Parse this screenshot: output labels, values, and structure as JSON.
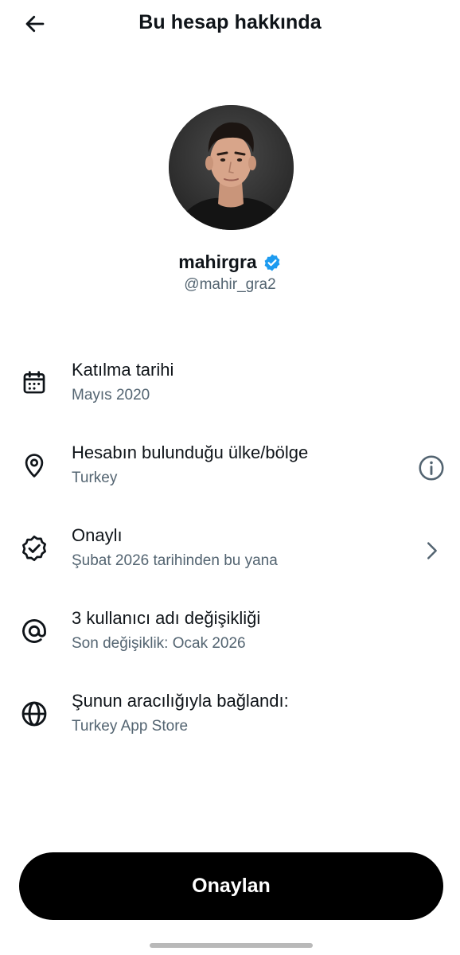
{
  "header": {
    "title": "Bu hesap hakkında",
    "back_icon": "arrow-left-icon"
  },
  "profile": {
    "display_name": "mahirgra",
    "handle": "@mahir_gra2",
    "verified": true,
    "verified_color": "#1d9bf0"
  },
  "info": [
    {
      "icon": "calendar-icon",
      "title": "Katılma tarihi",
      "subtitle": "Mayıs 2020"
    },
    {
      "icon": "location-pin-icon",
      "title": "Hesabın bulunduğu ülke/bölge",
      "subtitle": "Turkey",
      "trailing": "info-icon"
    },
    {
      "icon": "verified-badge-outline-icon",
      "title": "Onaylı",
      "subtitle": "Şubat 2026 tarihinden bu yana",
      "trailing": "chevron-right-icon"
    },
    {
      "icon": "at-sign-icon",
      "title": "3 kullanıcı adı değişikliği",
      "subtitle": "Son değişiklik: Ocak 2026"
    },
    {
      "icon": "globe-icon",
      "title": "Şunun aracılığıyla bağlandı:",
      "subtitle": "Turkey App Store"
    }
  ],
  "primary_button": {
    "label": "Onaylan"
  },
  "colors": {
    "text_primary": "#0f1419",
    "text_secondary": "#536471",
    "button_bg": "#000000"
  }
}
